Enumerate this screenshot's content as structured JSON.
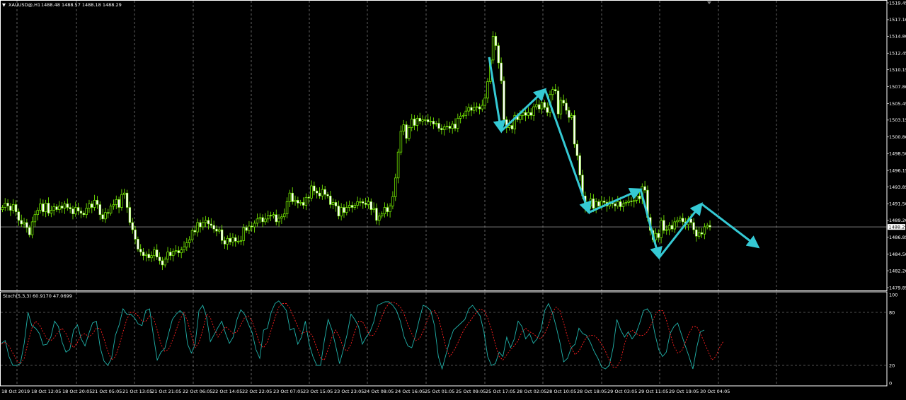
{
  "header": {
    "symbol_label": "XAUUSD@,H1",
    "ohlc": "1488.48 1488.57 1488.18 1488.29",
    "indicator_label": "Stoch(5,3,3) 60.9170 47.0699"
  },
  "colors": {
    "background": "#000000",
    "grid": "#c8c8c8",
    "candle": "#7cfc00",
    "bid_line": "#c0c0c0",
    "arrow": "#35c9d4",
    "stoch_main": "#20b2aa",
    "stoch_signal": "#ff2020",
    "text": "#ffffff"
  },
  "icons": {
    "menu_triangle": "triangle-down-icon",
    "shift_marker": "shift-marker-icon"
  },
  "chart_data": [
    {
      "type": "candlestick",
      "title": "XAUUSD@,H1",
      "ylim": [
        1479.85,
        1519.45
      ],
      "price_ticks": [
        "1519.45",
        "1517.10",
        "1514.80",
        "1512.45",
        "1510.15",
        "1507.80",
        "1505.45",
        "1503.15",
        "1500.80",
        "1498.50",
        "1496.15",
        "1493.85",
        "1491.50",
        "1489.20",
        "1486.85",
        "1484.50",
        "1482.20",
        "1479.85"
      ],
      "current_price": "1488.29",
      "x_labels": [
        "18 Oct 2019",
        "18 Oct 12:05",
        "18 Oct 20:05",
        "21 Oct 05:05",
        "21 Oct 13:05",
        "21 Oct 21:05",
        "22 Oct 06:05",
        "22 Oct 14:05",
        "22 Oct 22:05",
        "23 Oct 07:05",
        "23 Oct 15:05",
        "23 Oct 23:05",
        "24 Oct 08:05",
        "24 Oct 16:05",
        "25 Oct 01:05",
        "25 Oct 09:05",
        "25 Oct 17:05",
        "28 Oct 02:05",
        "28 Oct 10:05",
        "28 Oct 18:05",
        "29 Oct 03:05",
        "29 Oct 11:05",
        "29 Oct 19:05",
        "30 Oct 04:05"
      ],
      "close": [
        1491.0,
        1491.6,
        1491.2,
        1490.6,
        1491.4,
        1490.4,
        1489.2,
        1488.7,
        1488.9,
        1488.2,
        1487.2,
        1489.0,
        1490.0,
        1490.6,
        1491.5,
        1490.4,
        1491.6,
        1490.2,
        1490.6,
        1491.1,
        1490.7,
        1491.2,
        1490.9,
        1491.5,
        1491.0,
        1490.8,
        1490.1,
        1491.0,
        1490.5,
        1490.2,
        1490.0,
        1490.9,
        1491.5,
        1491.0,
        1492.0,
        1491.4,
        1490.0,
        1489.4,
        1490.3,
        1490.2,
        1491.2,
        1491.4,
        1492.1,
        1491.0,
        1492.8,
        1493.0,
        1491.0,
        1488.9,
        1487.9,
        1486.6,
        1485.2,
        1484.8,
        1484.3,
        1484.5,
        1484.0,
        1484.3,
        1485.1,
        1484.1,
        1483.6,
        1483.0,
        1483.8,
        1484.8,
        1484.3,
        1484.9,
        1485.0,
        1484.7,
        1485.1,
        1485.5,
        1486.1,
        1486.5,
        1487.8,
        1487.6,
        1488.9,
        1488.3,
        1488.9,
        1489.2,
        1488.7,
        1488.5,
        1488.0,
        1487.7,
        1487.9,
        1486.4,
        1485.9,
        1486.7,
        1486.2,
        1486.8,
        1486.3,
        1486.3,
        1486.4,
        1488.2,
        1487.8,
        1488.4,
        1488.3,
        1488.8,
        1489.4,
        1489.6,
        1489.0,
        1489.4,
        1489.9,
        1489.8,
        1490.0,
        1489.0,
        1489.5,
        1489.7,
        1490.1,
        1491.8,
        1493.0,
        1491.8,
        1492.0,
        1491.6,
        1491.7,
        1491.3,
        1492.4,
        1492.3,
        1494.0,
        1493.3,
        1493.0,
        1492.6,
        1493.5,
        1492.8,
        1492.6,
        1491.4,
        1491.7,
        1491.2,
        1489.8,
        1491.0,
        1490.3,
        1491.0,
        1491.3,
        1491.0,
        1491.3,
        1491.8,
        1491.8,
        1491.6,
        1491.4,
        1491.8,
        1490.7,
        1490.9,
        1489.2,
        1489.8,
        1490.1,
        1491.0,
        1490.4,
        1491.2,
        1492.5,
        1495.1,
        1498.7,
        1501.6,
        1502.5,
        1500.6,
        1502.1,
        1503.3,
        1502.4,
        1503.4,
        1503.0,
        1503.2,
        1503.2,
        1502.9,
        1503.0,
        1502.6,
        1502.7,
        1502.0,
        1501.8,
        1502.2,
        1502.3,
        1502.0,
        1502.6,
        1502.0,
        1503.4,
        1503.7,
        1503.8,
        1504.4,
        1504.9,
        1504.5,
        1504.9,
        1505.0,
        1504.7,
        1505.2,
        1506.2,
        1508.5,
        1511.5,
        1514.8,
        1513.5,
        1511.1,
        1508.6,
        1503.2,
        1502.1,
        1502.4,
        1501.9,
        1503.8,
        1503.2,
        1503.8,
        1504.2,
        1503.8,
        1504.2,
        1503.8,
        1505.0,
        1505.3,
        1504.7,
        1505.6,
        1504.9,
        1504.2,
        1506.7,
        1507.4,
        1507.2,
        1504.0,
        1505.9,
        1505.5,
        1504.5,
        1503.5,
        1503.8,
        1499.8,
        1498.2,
        1495.5,
        1492.6,
        1490.9,
        1491.2,
        1492.2,
        1490.9,
        1491.8,
        1491.2,
        1491.9,
        1491.7,
        1491.2,
        1491.8,
        1491.5,
        1491.2,
        1491.8,
        1491.1,
        1491.5,
        1491.7,
        1491.9,
        1491.8,
        1492.0,
        1492.6,
        1492.2,
        1493.9,
        1493.4,
        1489.6,
        1487.8,
        1486.5,
        1487.4,
        1486.8,
        1489.2,
        1487.8,
        1487.9,
        1488.5,
        1488.0,
        1489.0,
        1489.2,
        1489.5,
        1489.0,
        1488.6,
        1489.4,
        1488.9,
        1487.9,
        1487.0,
        1487.5,
        1487.3,
        1488.3,
        1488.5,
        1488.29
      ],
      "bid_arrows": [
        [
          1511.9,
          1501.6
        ],
        [
          1501.6,
          1507.4
        ],
        [
          1507.4,
          1490.3
        ],
        [
          1490.3,
          1493.5
        ],
        [
          1493.5,
          1484.0
        ],
        [
          1484.0,
          1491.5
        ],
        [
          1491.5,
          1485.5
        ]
      ]
    },
    {
      "type": "line",
      "title": "Stoch(5,3,3)",
      "ylim": [
        0,
        100
      ],
      "y_ticks": [
        "100",
        "80",
        "20",
        "0"
      ],
      "series": [
        {
          "name": "Stoch(5,3,3)",
          "key": "main",
          "values": [
            45,
            48,
            30,
            20,
            20,
            22,
            45,
            80,
            65,
            62,
            56,
            43,
            44,
            52,
            70,
            64,
            46,
            35,
            38,
            60,
            66,
            50,
            42,
            56,
            68,
            70,
            40,
            25,
            20,
            28,
            54,
            66,
            84,
            78,
            78,
            74,
            67,
            65,
            82,
            84,
            54,
            26,
            35,
            39,
            56,
            72,
            78,
            82,
            78,
            44,
            34,
            44,
            82,
            88,
            75,
            47,
            55,
            63,
            70,
            56,
            45,
            52,
            72,
            83,
            78,
            67,
            57,
            38,
            28,
            60,
            62,
            80,
            90,
            93,
            88,
            82,
            60,
            62,
            44,
            52,
            70,
            44,
            30,
            20,
            20,
            48,
            72,
            60,
            42,
            22,
            38,
            55,
            78,
            72,
            64,
            44,
            52,
            58,
            69,
            88,
            90,
            92,
            92,
            88,
            82,
            70,
            52,
            42,
            40,
            54,
            72,
            88,
            86,
            82,
            65,
            30,
            16,
            32,
            48,
            60,
            64,
            68,
            72,
            84,
            88,
            82,
            76,
            58,
            30,
            20,
            22,
            35,
            30,
            52,
            40,
            50,
            70,
            64,
            50,
            56,
            45,
            50,
            60,
            82,
            90,
            80,
            64,
            46,
            24,
            28,
            40,
            44,
            62,
            56,
            54,
            46,
            36,
            28,
            18,
            16,
            20,
            40,
            72,
            60,
            52,
            58,
            50,
            56,
            68,
            82,
            84,
            78,
            56,
            38,
            30,
            35,
            56,
            64,
            68,
            55,
            42,
            30,
            16,
            40,
            58,
            60
          ]
        },
        {
          "name": "Signal",
          "key": "signal",
          "values": [
            44,
            46,
            42,
            34,
            26,
            22,
            28,
            46,
            62,
            70,
            66,
            58,
            50,
            48,
            52,
            58,
            62,
            56,
            46,
            40,
            46,
            54,
            56,
            52,
            56,
            62,
            62,
            50,
            36,
            26,
            30,
            42,
            58,
            72,
            80,
            80,
            76,
            70,
            70,
            76,
            74,
            60,
            44,
            36,
            38,
            48,
            60,
            72,
            80,
            70,
            54,
            40,
            46,
            60,
            78,
            74,
            62,
            52,
            58,
            64,
            60,
            56,
            58,
            66,
            74,
            76,
            70,
            58,
            44,
            40,
            46,
            60,
            74,
            86,
            90,
            90,
            84,
            74,
            64,
            56,
            58,
            58,
            52,
            40,
            28,
            26,
            38,
            52,
            60,
            52,
            40,
            36,
            44,
            58,
            70,
            70,
            62,
            54,
            54,
            62,
            74,
            84,
            90,
            92,
            90,
            86,
            78,
            66,
            56,
            48,
            50,
            58,
            70,
            80,
            82,
            74,
            58,
            40,
            30,
            36,
            44,
            54,
            62,
            68,
            74,
            80,
            84,
            82,
            74,
            60,
            44,
            30,
            26,
            32,
            38,
            42,
            48,
            58,
            62,
            58,
            56,
            52,
            50,
            56,
            66,
            80,
            86,
            82,
            68,
            52,
            40,
            32,
            36,
            44,
            52,
            54,
            54,
            50,
            44,
            36,
            26,
            18,
            18,
            26,
            44,
            56,
            60,
            56,
            54,
            54,
            58,
            66,
            76,
            82,
            82,
            72,
            56,
            42,
            34,
            36,
            46,
            56,
            64,
            64,
            56,
            46,
            36,
            26,
            30,
            40,
            47
          ]
        }
      ]
    }
  ]
}
